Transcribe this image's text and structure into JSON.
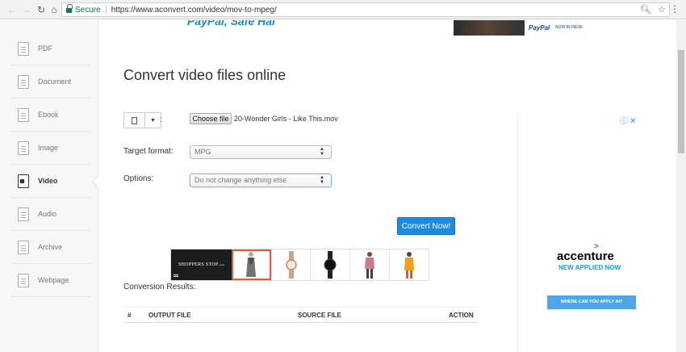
{
  "browser": {
    "secure_label": "Secure",
    "url": "https://www.aconvert.com/video/mov-to-mpeg/",
    "zoom_icon": "zoom-icon",
    "star_icon": "star-icon",
    "menu_icon": "menu-dots-icon"
  },
  "sidebar": {
    "items": [
      {
        "label": "PDF"
      },
      {
        "label": "Document"
      },
      {
        "label": "Ebook"
      },
      {
        "label": "Image"
      },
      {
        "label": "Video",
        "active": true
      },
      {
        "label": "Audio"
      },
      {
        "label": "Archive"
      },
      {
        "label": "Webpage"
      }
    ]
  },
  "banner": {
    "left_text": "PayPal, Safe Hai",
    "paypal_logo": "PayPal",
    "paypal_note": "NOW IN INDIA"
  },
  "main": {
    "title": "Convert video files online",
    "colon": ":",
    "choose_file_label": "Choose file",
    "file_name": "20-Wonder Girls - Like This.mov",
    "target_format_label": "Target format:",
    "target_format_value": "MPG",
    "options_label": "Options:",
    "options_value": "Do not change anything else",
    "convert_label": "Convert Now!",
    "results_label": "Conversion Results:",
    "table_headers": {
      "index": "#",
      "output": "OUTPUT FILE",
      "source": "SOURCE FILE",
      "action": "ACTION"
    }
  },
  "carousel": {
    "logo_text": "SHOPPERS STOP",
    "logo_suffix": ".com",
    "items": [
      "dress",
      "watch-gold",
      "watch-black",
      "top-pink",
      "top-orange"
    ]
  },
  "right_ad": {
    "choices": "ⓘ✕",
    "brand": "accenture",
    "tagline": "NEW APPLIED NOW",
    "button": "WHERE CAN YOU APPLY AI?"
  },
  "colors": {
    "accent_blue": "#1a8ae8",
    "secure_green": "#0b8043",
    "selected_border": "#e05b33"
  }
}
